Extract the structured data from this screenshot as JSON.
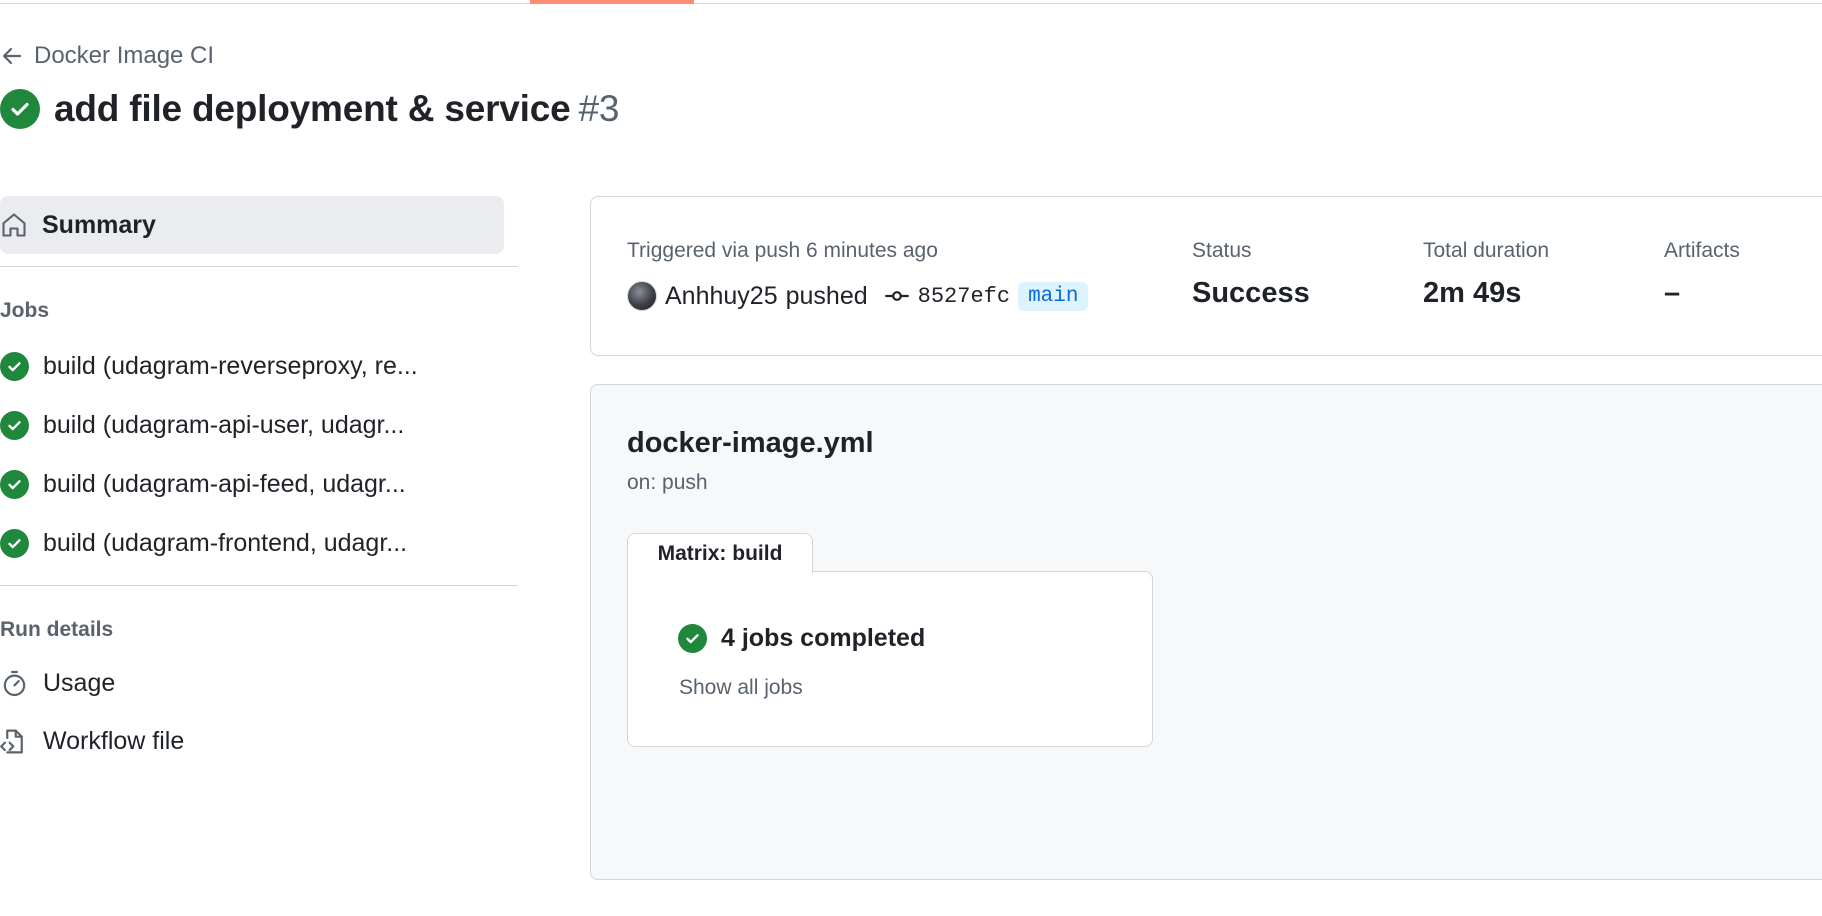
{
  "header": {
    "back_label": "Docker Image CI",
    "run_title": "add file deployment & service",
    "run_number": "#3"
  },
  "sidebar": {
    "summary_label": "Summary",
    "jobs_heading": "Jobs",
    "jobs": [
      {
        "label": "build (udagram-reverseproxy, re..."
      },
      {
        "label": "build (udagram-api-user, udagr..."
      },
      {
        "label": "build (udagram-api-feed, udagr..."
      },
      {
        "label": "build (udagram-frontend, udagr..."
      }
    ],
    "run_details_heading": "Run details",
    "usage_label": "Usage",
    "workflow_file_label": "Workflow file"
  },
  "summary": {
    "trigger_text": "Triggered via push 6 minutes ago",
    "actor": "Anhhuy25",
    "action": "pushed",
    "commit_sha": "8527efc",
    "branch": "main",
    "status_label": "Status",
    "status_value": "Success",
    "duration_label": "Total duration",
    "duration_value": "2m 49s",
    "artifacts_label": "Artifacts",
    "artifacts_value": "–"
  },
  "graph": {
    "workflow_file": "docker-image.yml",
    "trigger": "on: push",
    "matrix_tab_label": "Matrix: build",
    "matrix_status": "4 jobs completed",
    "show_all_label": "Show all jobs"
  },
  "colors": {
    "success": "#1f883d",
    "accent_underline": "#fd8c73",
    "branch_text": "#0969da",
    "branch_bg": "#ddf4ff",
    "muted_text": "#59636e",
    "border": "#d0d7de"
  },
  "icons": {
    "back": "arrow-left-icon",
    "status": "check-circle-fill-icon",
    "summary": "home-icon",
    "commit": "git-commit-icon",
    "usage": "stopwatch-icon",
    "workflow_file": "file-code-icon"
  }
}
